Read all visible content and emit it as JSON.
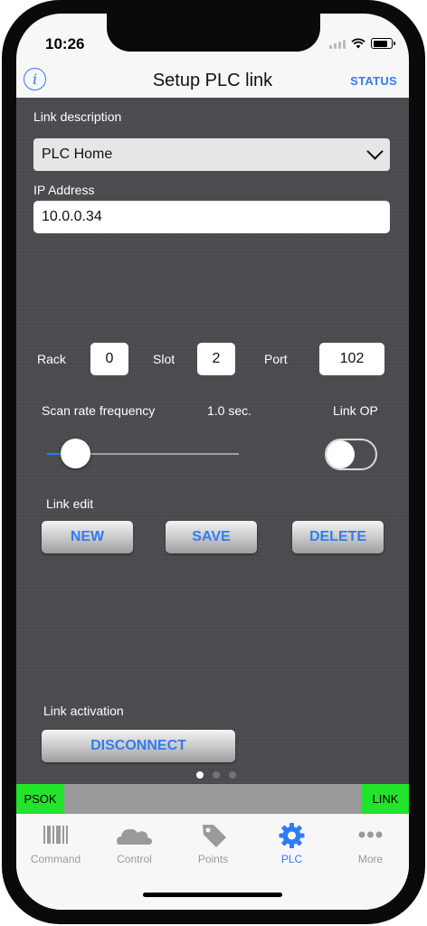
{
  "status_bar": {
    "time": "10:26"
  },
  "nav": {
    "title": "Setup PLC link",
    "status_button": "STATUS",
    "info_glyph": "i"
  },
  "form": {
    "link_description_label": "Link description",
    "link_description_value": "PLC Home",
    "ip_label": "IP Address",
    "ip_value": "10.0.0.34",
    "rack_label": "Rack",
    "rack_value": "0",
    "slot_label": "Slot",
    "slot_value": "2",
    "port_label": "Port",
    "port_value": "102",
    "scan_rate_label": "Scan rate frequency",
    "scan_rate_value": "1.0 sec.",
    "scan_rate_fraction": 0.15,
    "link_op_label": "Link OP",
    "link_op_on": false
  },
  "link_edit": {
    "label": "Link edit",
    "new_button": "NEW",
    "save_button": "SAVE",
    "delete_button": "DELETE"
  },
  "link_activation": {
    "label": "Link activation",
    "disconnect_button": "DISCONNECT"
  },
  "pager": {
    "pages": 3,
    "current": 1
  },
  "plc_status": {
    "psok": "PSOK",
    "link": "LINK",
    "ok_color": "#22e42a"
  },
  "tabs": [
    {
      "label": "Command",
      "icon": "barcode-icon",
      "active": false
    },
    {
      "label": "Control",
      "icon": "cloud-icon",
      "active": false
    },
    {
      "label": "Points",
      "icon": "tag-icon",
      "active": false
    },
    {
      "label": "PLC",
      "icon": "gear-icon",
      "active": true
    },
    {
      "label": "More",
      "icon": "more-dots-icon",
      "active": false
    }
  ],
  "colors": {
    "accent": "#2f7cf6",
    "background": "#4b4c4f"
  }
}
